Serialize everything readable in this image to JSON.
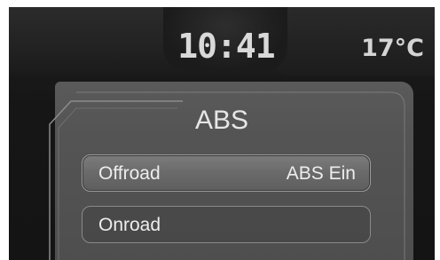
{
  "status_bar": {
    "time": "10:41",
    "temperature": "17°C"
  },
  "menu": {
    "title": "ABS",
    "items": [
      {
        "label": "Offroad",
        "value": "ABS Ein",
        "selected": true
      },
      {
        "label": "Onroad",
        "value": "",
        "selected": false
      }
    ]
  },
  "colors": {
    "screen_background": "#161616",
    "panel_background": "#555555",
    "text": "#e6e6e6",
    "selected_row": "#6e6e6e"
  }
}
